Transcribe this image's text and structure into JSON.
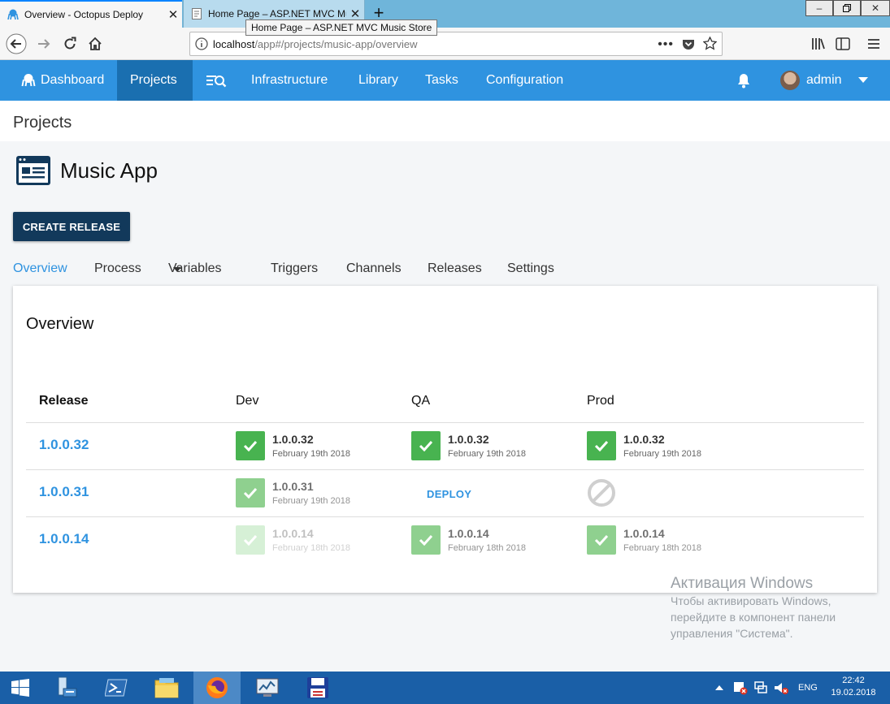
{
  "browser": {
    "tabs": [
      {
        "title": "Overview - Octopus Deploy",
        "active": true
      },
      {
        "title": "Home Page – ASP.NET MVC Music Store",
        "active": false
      }
    ],
    "tooltip": "Home Page – ASP.NET MVC Music Store",
    "url": {
      "host": "localhost",
      "path": "/app#/projects/music-app/overview"
    }
  },
  "app_nav": {
    "items": [
      "Dashboard",
      "Projects",
      "Infrastructure",
      "Library",
      "Tasks",
      "Configuration"
    ],
    "active": "Projects",
    "user": "admin"
  },
  "breadcrumb": "Projects",
  "project": {
    "name": "Music App",
    "create_release_label": "CREATE RELEASE"
  },
  "project_tabs": [
    "Overview",
    "Process",
    "Variables",
    "Triggers",
    "Channels",
    "Releases",
    "Settings"
  ],
  "overview": {
    "title": "Overview",
    "headers": [
      "Release",
      "Dev",
      "QA",
      "Prod"
    ],
    "rows": [
      {
        "release": "1.0.0.32",
        "dev": {
          "state": "success",
          "version": "1.0.0.32",
          "date": "February 19th 2018"
        },
        "qa": {
          "state": "success",
          "version": "1.0.0.32",
          "date": "February 19th 2018"
        },
        "prod": {
          "state": "success",
          "version": "1.0.0.32",
          "date": "February 19th 2018"
        }
      },
      {
        "release": "1.0.0.31",
        "dev": {
          "state": "previous",
          "version": "1.0.0.31",
          "date": "February 19th 2018"
        },
        "qa": {
          "state": "deploy",
          "label": "DEPLOY"
        },
        "prod": {
          "state": "blocked"
        }
      },
      {
        "release": "1.0.0.14",
        "dev": {
          "state": "faded",
          "version": "1.0.0.14",
          "date": "February 18th 2018"
        },
        "qa": {
          "state": "previous",
          "version": "1.0.0.14",
          "date": "February 18th 2018"
        },
        "prod": {
          "state": "previous",
          "version": "1.0.0.14",
          "date": "February 18th 2018"
        }
      }
    ]
  },
  "watermark": {
    "title": "Активация Windows",
    "line1": "Чтобы активировать Windows,",
    "line2": "перейдите в компонент панели",
    "line3": "управления \"Система\"."
  },
  "taskbar": {
    "language": "ENG",
    "time": "22:42",
    "date": "19.02.2018"
  },
  "colors": {
    "header_blue": "#2f93e0",
    "active_nav": "#1a6fb0",
    "button_navy": "#12395b",
    "success": "#48b350",
    "success_previous": "#8fd08f",
    "success_faded": "#d6f0d6"
  }
}
